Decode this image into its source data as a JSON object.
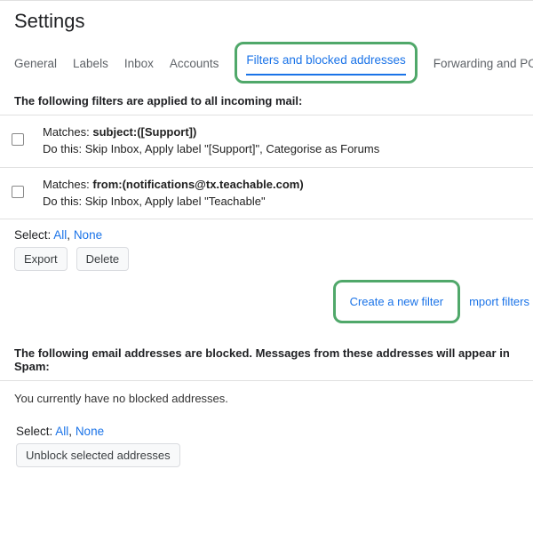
{
  "header": {
    "title": "Settings"
  },
  "tabs": {
    "general": "General",
    "labels": "Labels",
    "inbox": "Inbox",
    "accounts": "Accounts",
    "filters": "Filters and blocked addresses",
    "forwarding": "Forwarding and POP/IMAP"
  },
  "filtersSection": {
    "heading": "The following filters are applied to all incoming mail:",
    "rows": [
      {
        "matchesLabel": "Matches: ",
        "matchesValue": "subject:([Support])",
        "actionLabel": "Do this: ",
        "actionValue": "Skip Inbox, Apply label \"[Support]\", Categorise as Forums"
      },
      {
        "matchesLabel": "Matches: ",
        "matchesValue": "from:(notifications@tx.teachable.com)",
        "actionLabel": "Do this: ",
        "actionValue": "Skip Inbox, Apply label \"Teachable\""
      }
    ],
    "selectLabel": "Select: ",
    "selectAll": "All",
    "selectComma": ", ",
    "selectNone": "None",
    "exportBtn": "Export",
    "deleteBtn": "Delete",
    "createFilter": "Create a new filter",
    "importFilters": "mport filters"
  },
  "blockedSection": {
    "heading": "The following email addresses are blocked. Messages from these addresses will appear in Spam:",
    "empty": "You currently have no blocked addresses.",
    "selectLabel": "Select: ",
    "selectAll": "All",
    "selectComma": ", ",
    "selectNone": "None",
    "unblockBtn": "Unblock selected addresses"
  }
}
